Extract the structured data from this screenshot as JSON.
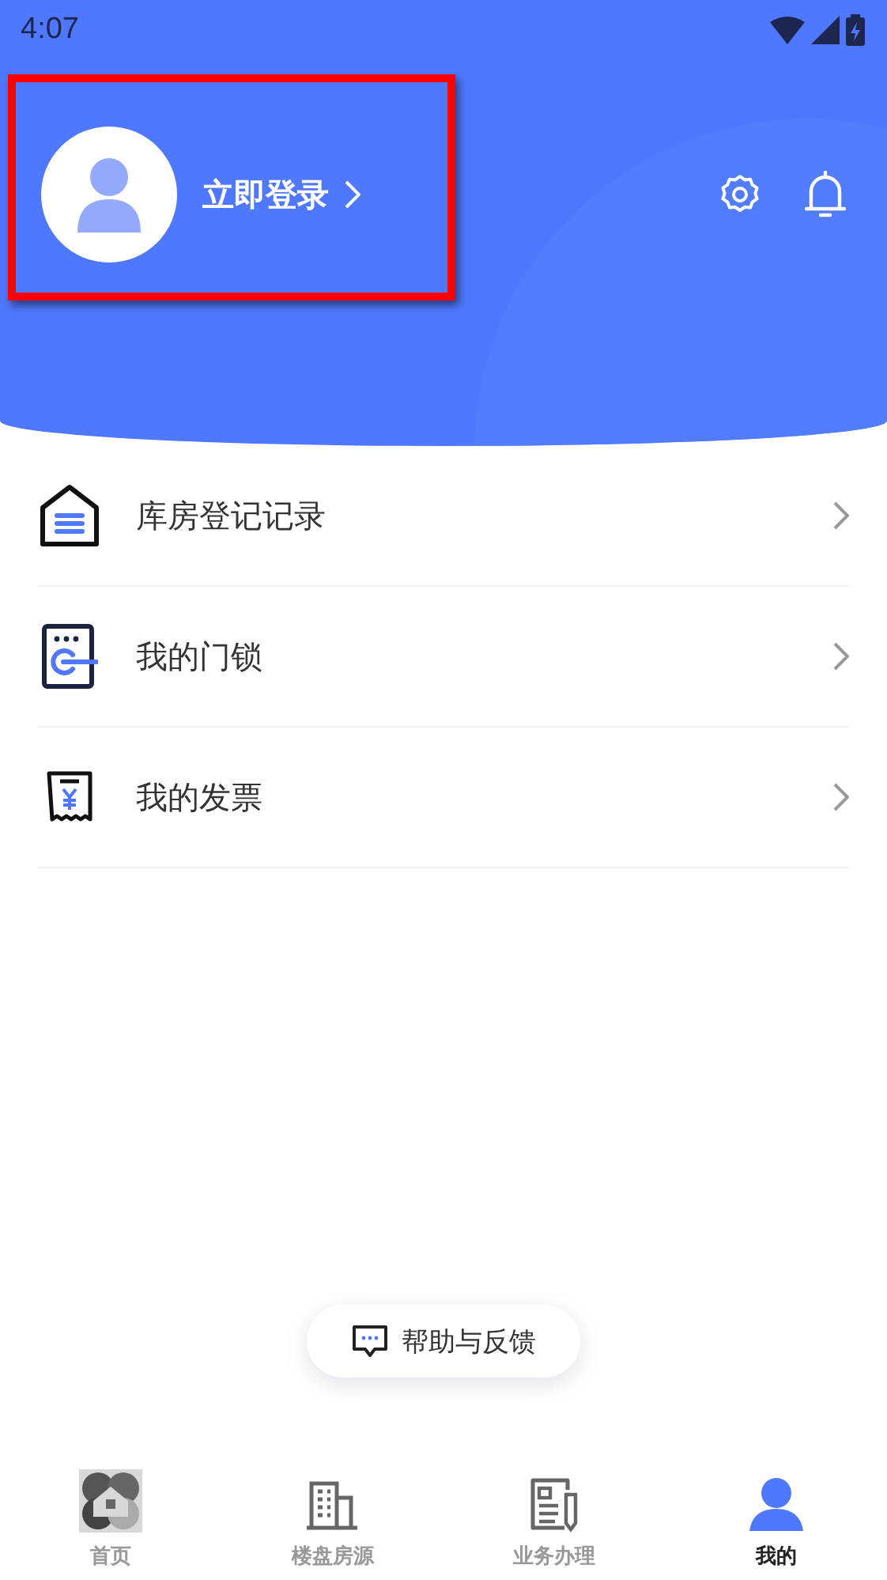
{
  "status_bar": {
    "time": "4:07"
  },
  "profile": {
    "login_label": "立即登录"
  },
  "menu": [
    {
      "kind": "warehouse",
      "label": "库房登记记录"
    },
    {
      "kind": "lock",
      "label": "我的门锁"
    },
    {
      "kind": "invoice",
      "label": "我的发票"
    }
  ],
  "help_button": {
    "label": "帮助与反馈"
  },
  "tabs": [
    {
      "kind": "home",
      "label": "首页",
      "selected": false
    },
    {
      "kind": "building",
      "label": "楼盘房源",
      "selected": false
    },
    {
      "kind": "business",
      "label": "业务办理",
      "selected": false
    },
    {
      "kind": "profile",
      "label": "我的",
      "selected": true
    }
  ]
}
